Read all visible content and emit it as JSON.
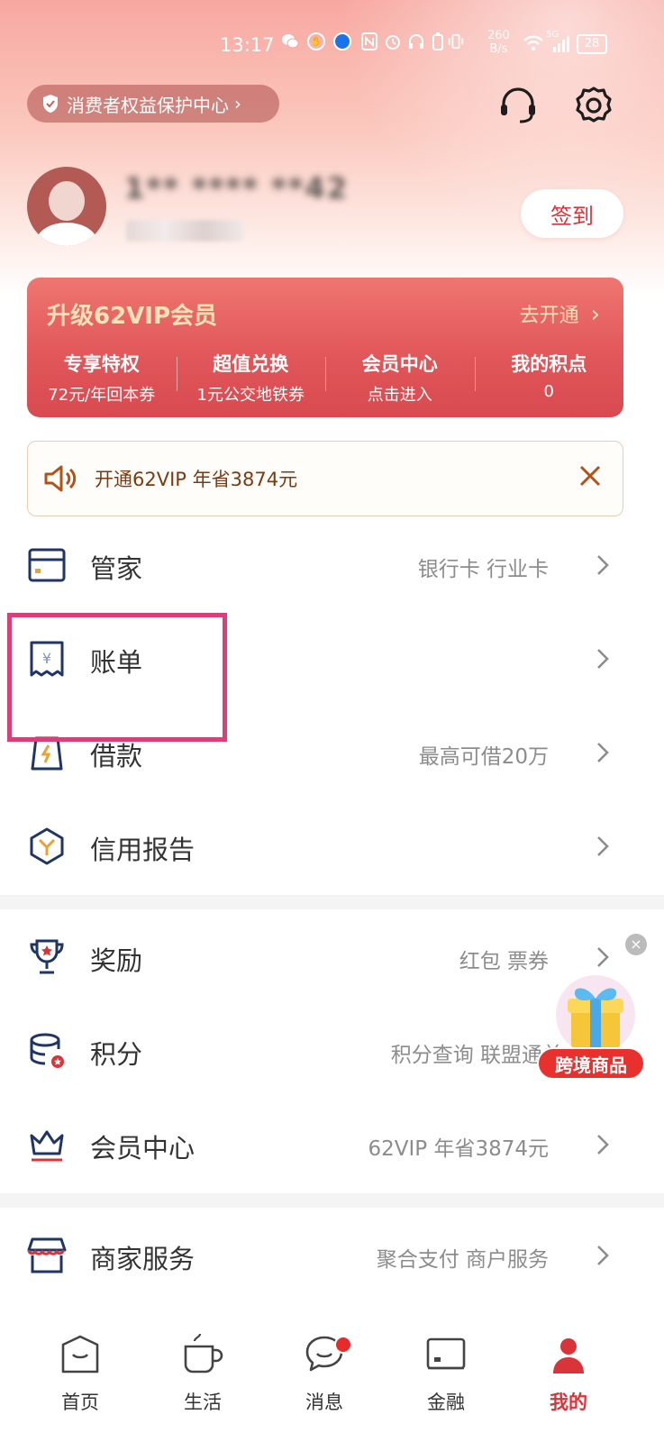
{
  "status_bar": {
    "time": "13:17",
    "net_speed_value": "260",
    "net_speed_unit": "B/s",
    "network": "5G",
    "battery": "28"
  },
  "header": {
    "rights_label": "消费者权益保护中心",
    "support_icon": "headset-icon",
    "settings_icon": "gear-icon"
  },
  "profile": {
    "name_masked": "1** **** **42",
    "checkin_label": "签到"
  },
  "vip": {
    "title": "升级62VIP会员",
    "open_label": "去开通",
    "columns": [
      {
        "title": "专享特权",
        "sub": "72元/年回本券"
      },
      {
        "title": "超值兑换",
        "sub": "1元公交地铁券"
      },
      {
        "title": "会员中心",
        "sub": "点击进入"
      },
      {
        "title": "我的积点",
        "sub": "0"
      }
    ]
  },
  "notice": {
    "text": "开通62VIP 年省3874元"
  },
  "menu": {
    "group1": [
      {
        "label": "管家",
        "sub": "银行卡 行业卡",
        "icon": "card-icon"
      },
      {
        "label": "账单",
        "sub": "",
        "icon": "bill-icon"
      },
      {
        "label": "借款",
        "sub": "最高可借20万",
        "icon": "loan-icon"
      },
      {
        "label": "信用报告",
        "sub": "",
        "icon": "credit-report-icon"
      }
    ],
    "group2": [
      {
        "label": "奖励",
        "sub": "红包 票券",
        "icon": "trophy-icon"
      },
      {
        "label": "积分",
        "sub": "积分查询 联盟通兑",
        "icon": "points-icon"
      },
      {
        "label": "会员中心",
        "sub": "62VIP 年省3874元",
        "icon": "crown-icon"
      }
    ],
    "group3": [
      {
        "label": "商家服务",
        "sub": "聚合支付 商户服务",
        "icon": "store-icon"
      }
    ]
  },
  "promo": {
    "label": "跨境商品"
  },
  "bottom_nav": [
    {
      "label": "首页",
      "icon": "home-icon"
    },
    {
      "label": "生活",
      "icon": "cup-icon"
    },
    {
      "label": "消息",
      "icon": "message-icon"
    },
    {
      "label": "金融",
      "icon": "finance-card-icon"
    },
    {
      "label": "我的",
      "icon": "profile-icon"
    }
  ],
  "colors": {
    "accent_red": "#d9343a",
    "vip_gold": "#fde2b8",
    "icon_navy": "#1f3566",
    "highlight_pink": "#d8407a"
  }
}
